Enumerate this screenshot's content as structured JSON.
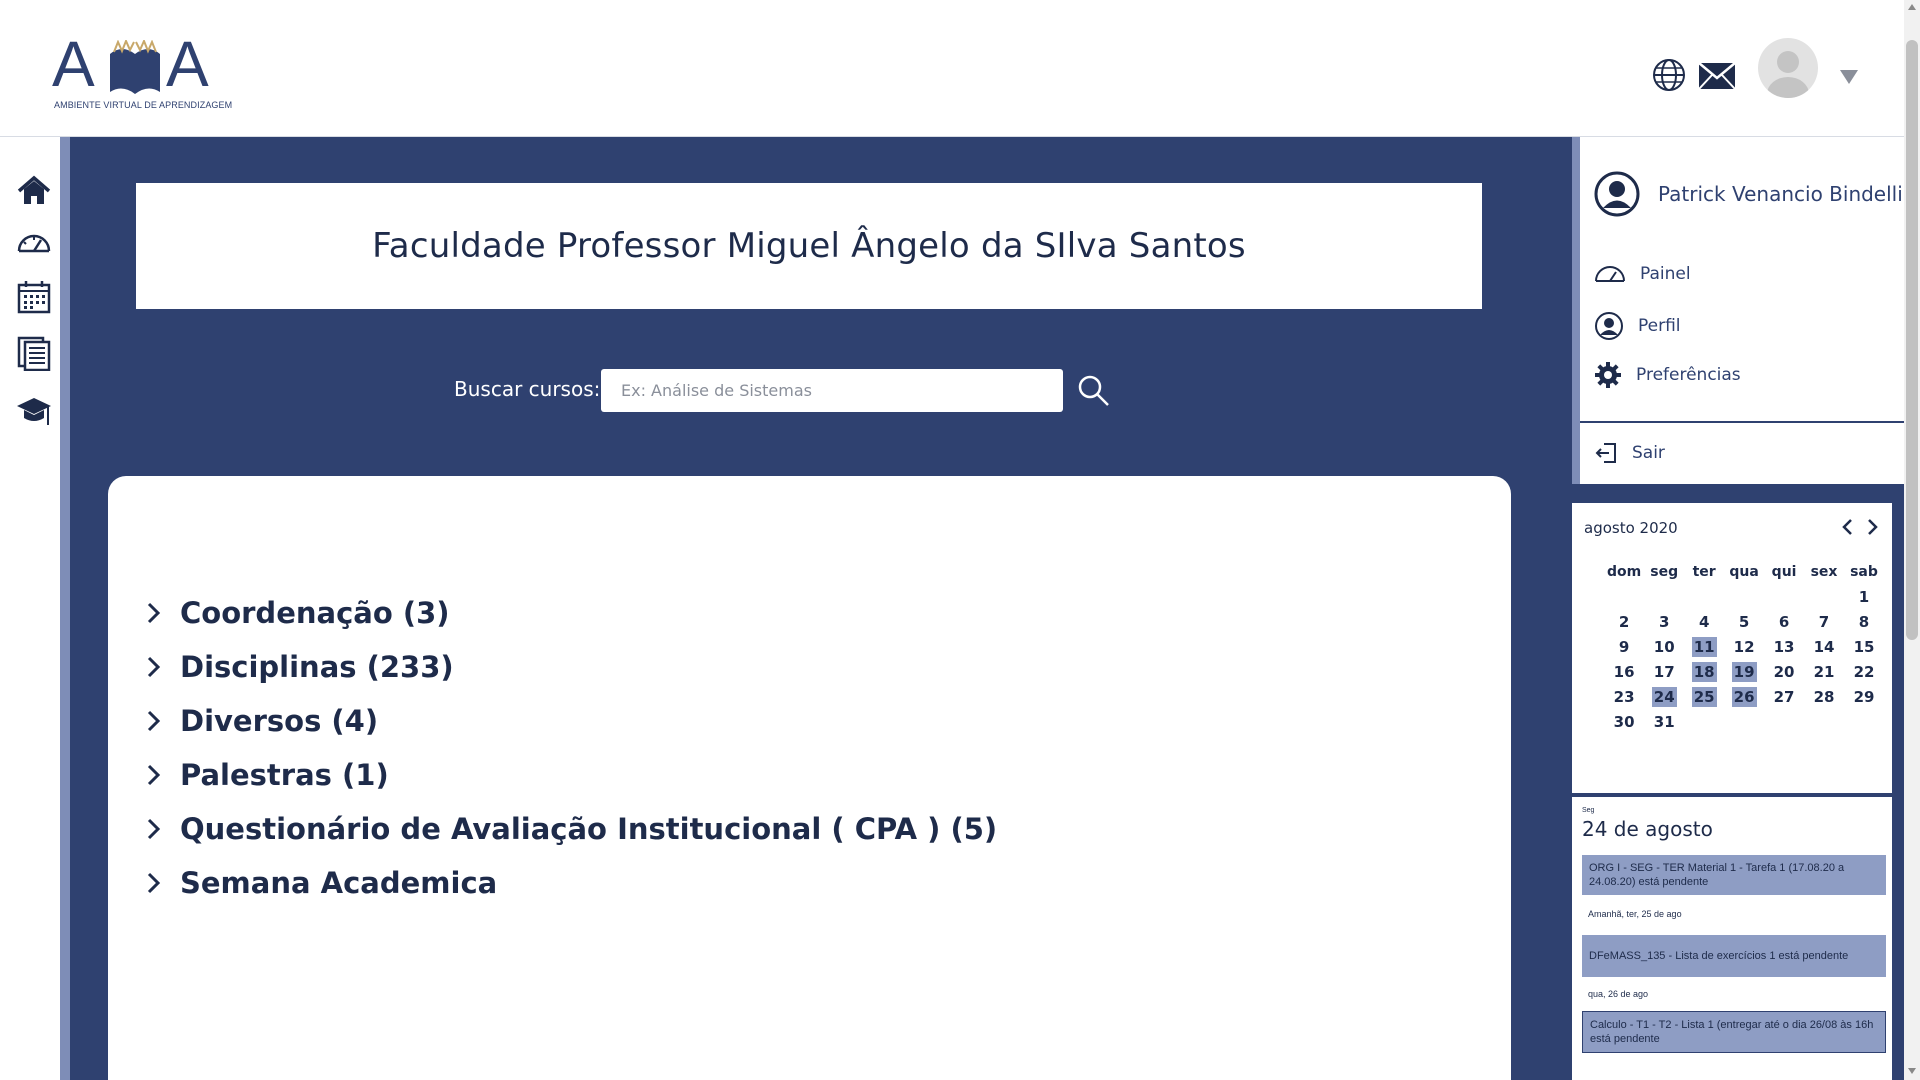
{
  "header": {
    "logo_letters_left": "A",
    "logo_letters_right": "A",
    "logo_tagline": "AMBIENTE VIRTUAL DE APRENDIZAGEM",
    "icons": [
      "globe-icon",
      "mail-icon",
      "avatar",
      "chevron-down-icon"
    ]
  },
  "leftnav": {
    "items": [
      "home-icon",
      "dashboard-icon",
      "calendar-icon",
      "documents-icon",
      "graduation-cap-icon"
    ]
  },
  "main": {
    "title": "Faculdade Professor Miguel Ângelo da SIlva Santos",
    "search": {
      "label": "Buscar cursos:",
      "placeholder": "Ex: Análise de Sistemas",
      "value": ""
    },
    "categories": [
      "Coordenação (3)",
      "Disciplinas (233)",
      "Diversos (4)",
      "Palestras (1)",
      "Questionário de Avaliação Institucional ( CPA ) (5)",
      "Semana Academica"
    ]
  },
  "usermenu": {
    "name": "Patrick Venancio Bindelli",
    "items": [
      "Painel",
      "Perfil",
      "Preferências"
    ],
    "logout": "Sair"
  },
  "calendar": {
    "month": "agosto 2020",
    "weekdays": [
      "dom",
      "seg",
      "ter",
      "qua",
      "qui",
      "sex",
      "sab"
    ],
    "weeks": [
      [
        "",
        "",
        "",
        "",
        "",
        "",
        "1"
      ],
      [
        "2",
        "3",
        "4",
        "5",
        "6",
        "7",
        "8"
      ],
      [
        "9",
        "10",
        "11",
        "12",
        "13",
        "14",
        "15"
      ],
      [
        "16",
        "17",
        "18",
        "19",
        "20",
        "21",
        "22"
      ],
      [
        "23",
        "24",
        "25",
        "26",
        "27",
        "28",
        "29"
      ],
      [
        "30",
        "31",
        "",
        "",
        "",
        "",
        ""
      ]
    ],
    "event_days": [
      "11",
      "18",
      "19",
      "24",
      "25",
      "26"
    ]
  },
  "upcoming": {
    "day_small": "Seg",
    "date": "24 de agosto",
    "events": [
      "ORG I - SEG - TER Material 1 - Tarefa 1 (17.08.20 a 24.08.20) está pendente",
      "DFeMASS_135 - Lista de exercícios 1 está pendente",
      "Calculo - T1 - T2 - Lista 1 (entregar até o dia 26/08 às 16h está pendente"
    ],
    "notes": [
      "Amanhã, ter, 25 de ago",
      "qua, 26 de ago"
    ]
  },
  "colors": {
    "primary": "#2f4170",
    "accent": "#7e8db7",
    "event_fill": "#8e9dc4"
  }
}
